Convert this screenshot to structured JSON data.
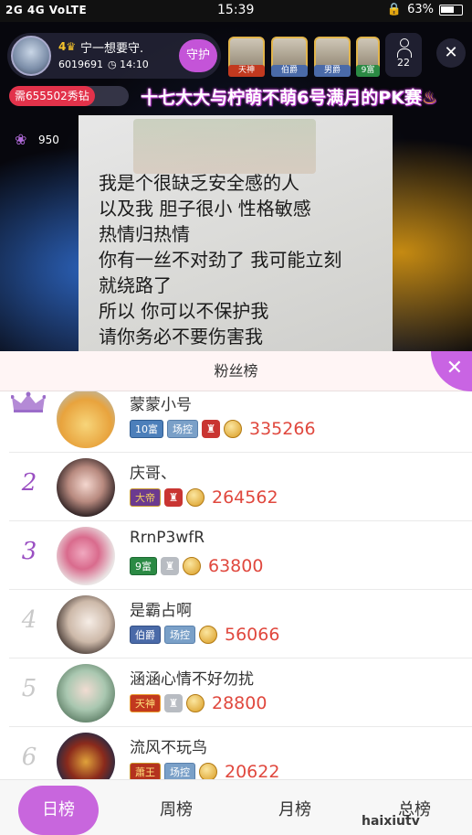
{
  "status_bar": {
    "left": "2G 4G VoLTE",
    "time": "15:39",
    "battery": "63%"
  },
  "host": {
    "level": "4",
    "name": "宁一想要守.",
    "id": "6019691",
    "duration": "14:10",
    "guard_label": "守护"
  },
  "viewers": [
    {
      "badge": "天神",
      "color": "#c2391f"
    },
    {
      "badge": "伯爵",
      "color": "#4a6aa8"
    },
    {
      "badge": "男爵",
      "color": "#4a6aa8"
    },
    {
      "badge": "9富",
      "color": "#2b8a44"
    }
  ],
  "viewer_count": "22",
  "diamond_pill": "需655502秀钻",
  "pk_banner": "十七大大与柠萌不萌6号满月的PK赛",
  "flowers": "950",
  "lyrics": [
    "我是个很缺乏安全感的人",
    "以及我 胆子很小 性格敏感",
    "热情归热情",
    "你有一丝不对劲了 我可能立刻",
    "就绕路了",
    "所以 你可以不保护我",
    "请你务必不要伤害我"
  ],
  "panel": {
    "title": "粉丝榜",
    "close": "✕"
  },
  "fans": [
    {
      "rank": "",
      "name": "蒙蒙小号",
      "badges": [
        "10富",
        "场控"
      ],
      "badge_classes": [
        "b-rich",
        "b-ctrl"
      ],
      "shield": "red",
      "score": "335266"
    },
    {
      "rank": "2",
      "name": "庆哥、",
      "badges": [
        "大帝"
      ],
      "badge_classes": [
        "b-emperor"
      ],
      "shield": "red",
      "score": "264562"
    },
    {
      "rank": "3",
      "name": "RrnP3wfR",
      "badges": [
        "9富"
      ],
      "badge_classes": [
        "b-green"
      ],
      "shield": "gray",
      "score": "63800"
    },
    {
      "rank": "4",
      "name": "是霸占啊",
      "badges": [
        "伯爵",
        "场控"
      ],
      "badge_classes": [
        "b-earl",
        "b-ctrl"
      ],
      "shield": "",
      "score": "56066"
    },
    {
      "rank": "5",
      "name": "涵涵心情不好勿扰",
      "badges": [
        "天神"
      ],
      "badge_classes": [
        "b-god"
      ],
      "shield": "gray",
      "score": "28800"
    },
    {
      "rank": "6",
      "name": "流风不玩鸟",
      "badges": [
        "蕭王",
        "场控"
      ],
      "badge_classes": [
        "b-king",
        "b-ctrl"
      ],
      "shield": "",
      "score": "20622"
    }
  ],
  "tabs": [
    "日榜",
    "周榜",
    "月榜",
    "总榜"
  ],
  "watermark": "haixiutv"
}
